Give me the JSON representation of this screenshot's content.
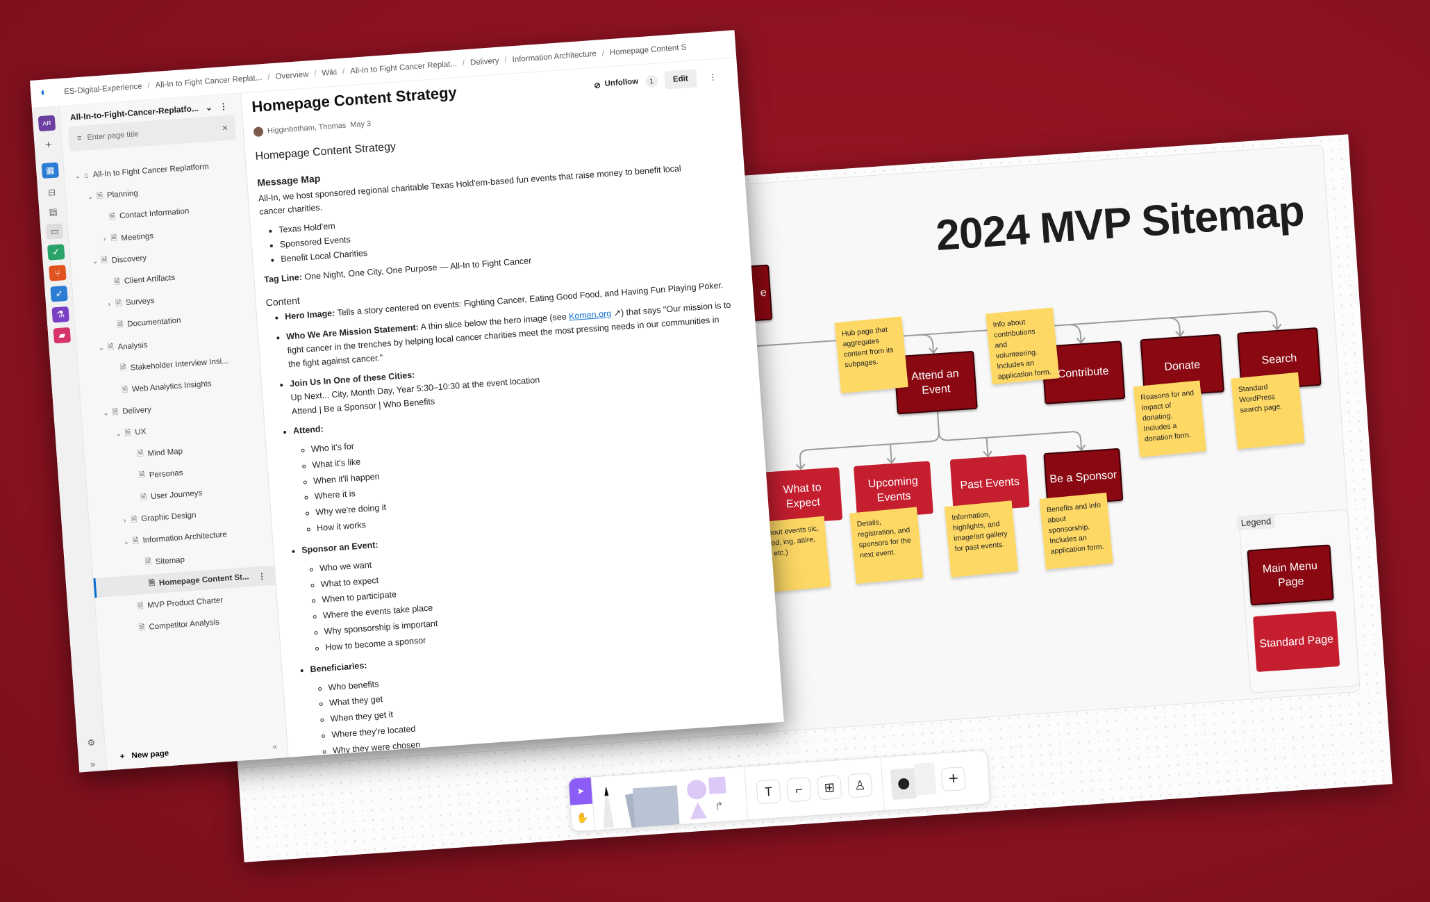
{
  "colors": {
    "background": "#8c1221",
    "main_menu_page": "#8a0812",
    "standard_page": "#c41e2f",
    "sticky": "#fdd865",
    "accent": "#0a6ed1",
    "tool_active": "#8b5cf6"
  },
  "whiteboard": {
    "title": "2024 MVP Sitemap",
    "hidden_node": "e",
    "nodes": {
      "attend": "Attend an Event",
      "contribute": "Contribute",
      "donate": "Donate",
      "search": "Search",
      "what_to_expect": "What to Expect",
      "upcoming": "Upcoming Events",
      "past": "Past Events",
      "sponsor": "Be a Sponsor"
    },
    "notes": {
      "attend": "Hub page that aggregates content from its subpages.",
      "contribute": "Info about contributions and volunteering. Includes an application form.",
      "donate": "Reasons for and impact of donating. Includes a donation form.",
      "search": "Standard WordPress search page.",
      "what_to_expect": "about events sic, food, ing, attire, s, etc.)",
      "upcoming": "Details, registration, and sponsors for the next event.",
      "past": "Information, highlights, and image/art gallery for past events.",
      "sponsor": "Benefits and info about sponsorship. Includes an application form."
    },
    "legend": {
      "label": "Legend",
      "main": "Main Menu Page",
      "standard": "Standard Page"
    },
    "toolbar": {
      "icons": [
        "select-icon",
        "hand-icon",
        "pen-icon",
        "sticky-notes-icon",
        "shapes-icon",
        "text-icon",
        "frame-icon",
        "table-icon",
        "stamp-icon",
        "templates-icon",
        "add-icon"
      ],
      "text_glyph": "T",
      "add_glyph": "+"
    }
  },
  "wiki": {
    "breadcrumbs": [
      "ES-Digital-Experience",
      "All-In to Fight Cancer Replat...",
      "Overview",
      "Wiki",
      "All-In to Fight Cancer Replat...",
      "Delivery",
      "Information Architecture",
      "Homepage Content S"
    ],
    "avatar": "AR",
    "sidebar": {
      "project": "All-In-to-Fight-Cancer-Replatfo...",
      "search_placeholder": "Enter page title",
      "new_page": "New page",
      "tree": [
        {
          "label": "All-In to Fight Cancer Replatform",
          "level": 0,
          "state": "open",
          "home": true
        },
        {
          "label": "Planning",
          "level": 1,
          "state": "open"
        },
        {
          "label": "Contact Information",
          "level": 2,
          "state": ""
        },
        {
          "label": "Meetings",
          "level": 2,
          "state": "closed"
        },
        {
          "label": "Discovery",
          "level": 1,
          "state": "open"
        },
        {
          "label": "Client Artifacts",
          "level": 2,
          "state": ""
        },
        {
          "label": "Surveys",
          "level": 2,
          "state": "closed"
        },
        {
          "label": "Documentation",
          "level": 2,
          "state": ""
        },
        {
          "label": "Analysis",
          "level": 1,
          "state": "open"
        },
        {
          "label": "Stakeholder Interview Insi...",
          "level": 2,
          "state": ""
        },
        {
          "label": "Web Analytics Insights",
          "level": 2,
          "state": ""
        },
        {
          "label": "Delivery",
          "level": 1,
          "state": "open"
        },
        {
          "label": "UX",
          "level": 2,
          "state": "open"
        },
        {
          "label": "Mind Map",
          "level": 3,
          "state": ""
        },
        {
          "label": "Personas",
          "level": 3,
          "state": ""
        },
        {
          "label": "User Journeys",
          "level": 3,
          "state": ""
        },
        {
          "label": "Graphic Design",
          "level": 2,
          "state": "closed"
        },
        {
          "label": "Information Architecture",
          "level": 2,
          "state": "open"
        },
        {
          "label": "Sitemap",
          "level": 3,
          "state": ""
        },
        {
          "label": "Homepage Content St...",
          "level": 3,
          "state": "",
          "selected": true
        },
        {
          "label": "MVP Product Charter",
          "level": 2,
          "state": ""
        },
        {
          "label": "Competitor Analysis",
          "level": 2,
          "state": ""
        }
      ]
    },
    "page": {
      "title": "Homepage Content Strategy",
      "author": "Higginbotham, Thomas",
      "date": "May 3",
      "unfollow": "Unfollow",
      "follow_count": "1",
      "edit": "Edit",
      "h2": "Homepage Content Strategy",
      "message_map": "Message Map",
      "intro": "All-In, we host sponsored regional charitable Texas Hold'em-based fun events that raise money to benefit local cancer charities.",
      "bullets": [
        "Texas Hold'em",
        "Sponsored Events",
        "Benefit Local Charities"
      ],
      "tagline_label": "Tag Line:",
      "tagline": "One Night, One City, One Purpose — All-In to Fight Cancer",
      "content_heading": "Content",
      "hero_label": "Hero Image:",
      "hero": "Tells a story centered on events: Fighting Cancer, Eating Good Food, and Having Fun Playing Poker.",
      "mission_label": "Who We Are Mission Statement:",
      "mission_a": "A thin slice below the hero image (see",
      "mission_link": "Komen.org",
      "mission_b": "↗) that says \"Our mission is to fight cancer in the trenches by helping local cancer charities meet the most pressing needs in our communities in the fight against cancer.\"",
      "join_label": "Join Us In One of these Cities:",
      "join_1": "Up Next... City, Month Day, Year 5:30–10:30 at the event location",
      "join_2": "Attend | Be a Sponsor | Who Benefits",
      "sections": [
        {
          "label": "Attend:",
          "items": [
            "Who it's for",
            "What it's like",
            "When it'll happen",
            "Where it is",
            "Why we're doing it",
            "How it works"
          ]
        },
        {
          "label": "Sponsor an Event:",
          "items": [
            "Who we want",
            "What to expect",
            "When to participate",
            "Where the events take place",
            "Why sponsorship is important",
            "How to become a sponsor"
          ]
        },
        {
          "label": "Beneficiaries:",
          "items": [
            "Who benefits",
            "What they get",
            "When they get it",
            "Where they're located",
            "Why they were chosen"
          ]
        }
      ]
    }
  }
}
